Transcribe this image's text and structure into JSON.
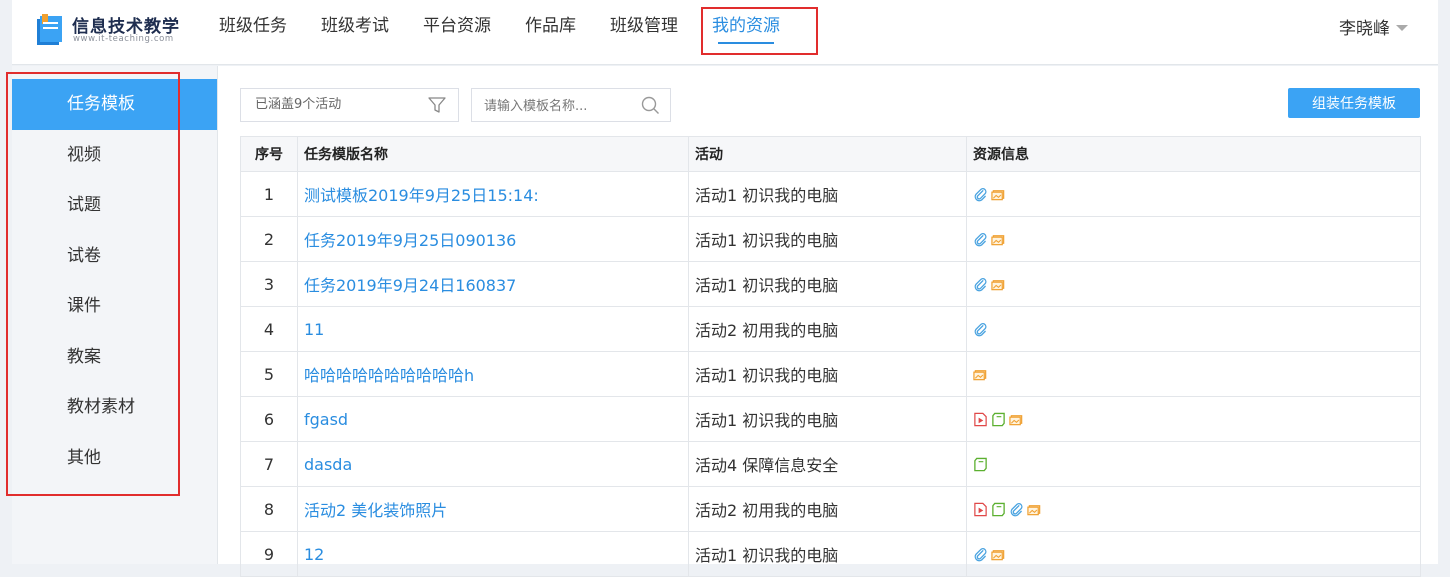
{
  "header": {
    "logo_title": "信息技术教学",
    "logo_sub": "www.it-teaching.com",
    "nav": [
      {
        "label": "班级任务",
        "active": false
      },
      {
        "label": "班级考试",
        "active": false
      },
      {
        "label": "平台资源",
        "active": false
      },
      {
        "label": "作品库",
        "active": false
      },
      {
        "label": "班级管理",
        "active": false
      },
      {
        "label": "我的资源",
        "active": true
      }
    ],
    "user_name": "李晓峰"
  },
  "sidebar": {
    "items": [
      {
        "label": "任务模板",
        "active": true
      },
      {
        "label": "视频",
        "active": false
      },
      {
        "label": "试题",
        "active": false
      },
      {
        "label": "试卷",
        "active": false
      },
      {
        "label": "课件",
        "active": false
      },
      {
        "label": "教案",
        "active": false
      },
      {
        "label": "教材素材",
        "active": false
      },
      {
        "label": "其他",
        "active": false
      }
    ]
  },
  "toolbar": {
    "filter_label": "已涵盖9个活动",
    "search_placeholder": "请输入模板名称...",
    "assemble_button": "组装任务模板"
  },
  "table": {
    "columns": [
      "序号",
      "任务模版名称",
      "活动",
      "资源信息"
    ],
    "rows": [
      {
        "index": "1",
        "name": "测试模板2019年9月25日15:14:",
        "activity": "活动1 初识我的电脑",
        "resources": [
          "paperclip-icon",
          "image-icon"
        ]
      },
      {
        "index": "2",
        "name": "任务2019年9月25日090136",
        "activity": "活动1 初识我的电脑",
        "resources": [
          "paperclip-icon",
          "image-icon"
        ]
      },
      {
        "index": "3",
        "name": "任务2019年9月24日160837",
        "activity": "活动1 初识我的电脑",
        "resources": [
          "paperclip-icon",
          "image-icon"
        ]
      },
      {
        "index": "4",
        "name": "11",
        "activity": "活动2 初用我的电脑",
        "resources": [
          "paperclip-icon"
        ]
      },
      {
        "index": "5",
        "name": "哈哈哈哈哈哈哈哈哈哈h",
        "activity": "活动1 初识我的电脑",
        "resources": [
          "image-icon"
        ]
      },
      {
        "index": "6",
        "name": "fgasd",
        "activity": "活动1 初识我的电脑",
        "resources": [
          "video-icon",
          "document-icon",
          "image-icon"
        ]
      },
      {
        "index": "7",
        "name": "dasda",
        "activity": "活动4 保障信息安全",
        "resources": [
          "document-icon"
        ]
      },
      {
        "index": "8",
        "name": "活动2 美化装饰照片",
        "activity": "活动2 初用我的电脑",
        "resources": [
          "video-icon",
          "document-icon",
          "paperclip-icon",
          "image-icon"
        ]
      },
      {
        "index": "9",
        "name": "12",
        "activity": "活动1 初识我的电脑",
        "resources": [
          "paperclip-icon",
          "image-icon"
        ]
      }
    ]
  },
  "colors": {
    "accent": "#3ba3f4",
    "link": "#2a8de0",
    "highlight_border": "#e12d2d",
    "icon_paperclip": "#4aa3e0",
    "icon_image": "#f0a030",
    "icon_video": "#e04848",
    "icon_document": "#5cb030"
  }
}
